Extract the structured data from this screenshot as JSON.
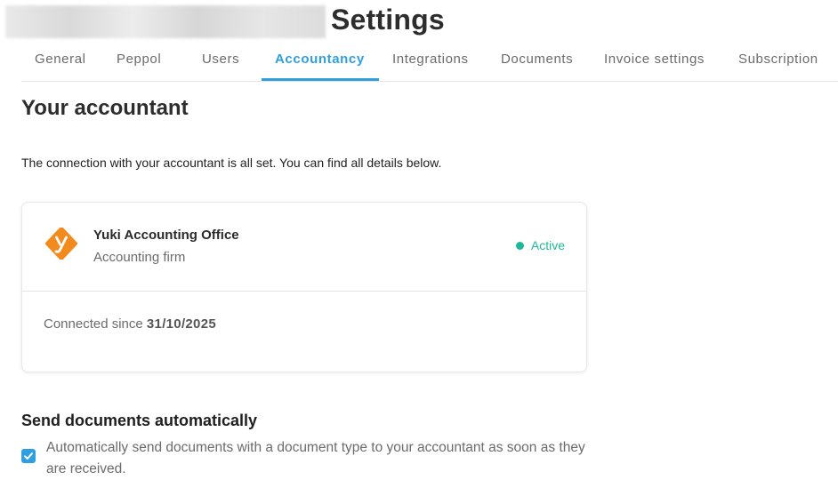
{
  "header": {
    "title": "Settings"
  },
  "tabs": [
    {
      "label": "General",
      "active": false
    },
    {
      "label": "Peppol",
      "active": false
    },
    {
      "label": "Users",
      "active": false
    },
    {
      "label": "Accountancy",
      "active": true
    },
    {
      "label": "Integrations",
      "active": false
    },
    {
      "label": "Documents",
      "active": false
    },
    {
      "label": "Invoice settings",
      "active": false
    },
    {
      "label": "Subscription",
      "active": false
    }
  ],
  "main": {
    "title": "Your accountant",
    "intro": "The connection with your accountant is all set. You can find all details below.",
    "accountant_card": {
      "logo_icon": "yuki-logo-icon",
      "name": "Yuki Accounting Office",
      "type": "Accounting firm",
      "status": "Active",
      "connected_prefix": "Connected since ",
      "connected_date": "31/10/2025"
    },
    "auto_send": {
      "title": "Send documents automatically",
      "checked": true,
      "label": "Automatically send documents with a document type to your accountant as soon as they are received."
    }
  },
  "colors": {
    "accent": "#2f9fe0",
    "status_active": "#1fb89a",
    "logo_orange": "#f28a1e"
  }
}
